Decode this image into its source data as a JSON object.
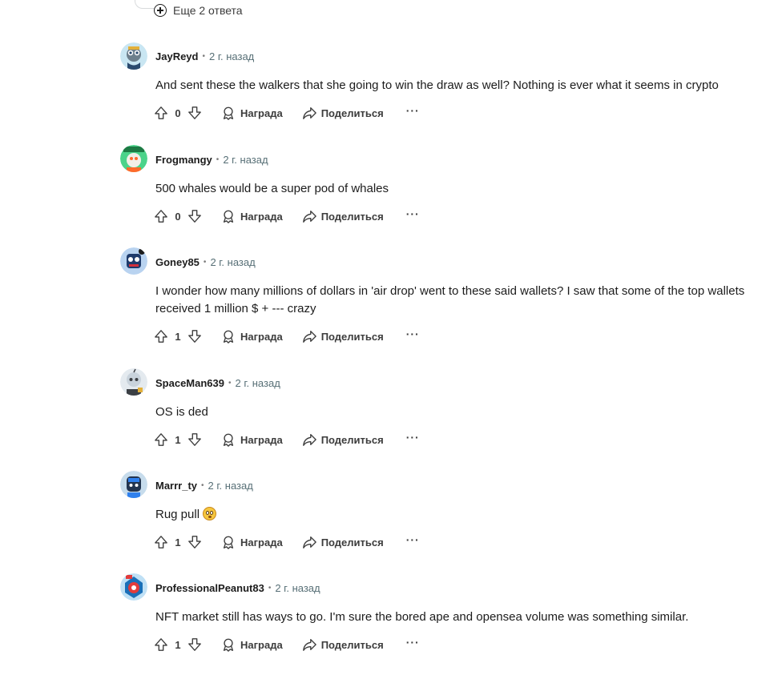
{
  "more_replies": {
    "label": "Еще 2 ответа",
    "icon": "plus-circle-icon"
  },
  "actions": {
    "award": "Награда",
    "share": "Поделиться",
    "more": "···"
  },
  "comments": [
    {
      "author": "JayReyd",
      "time": "2 г. назад",
      "body": "And sent these the walkers that she going to win the draw as well? Nothing is ever what it seems in crypto",
      "score": "0",
      "avatar_colors": [
        "#2a4a6e",
        "#9fb5c8"
      ]
    },
    {
      "author": "Frogmangy",
      "time": "2 г. назад",
      "body": "500 whales would be a super pod of whales",
      "score": "0",
      "avatar_colors": [
        "#2bb673",
        "#ff6a2b"
      ]
    },
    {
      "author": "Goney85",
      "time": "2 г. назад",
      "body": "I wonder how many millions of dollars in 'air drop' went to these said wallets? I saw that some of the top wallets received 1 million $ + --- crazy",
      "score": "1",
      "avatar_colors": [
        "#1f3b6b",
        "#d3303c"
      ]
    },
    {
      "author": "SpaceMan639",
      "time": "2 г. назад",
      "body": "OS is ded",
      "score": "1",
      "avatar_colors": [
        "#c9d3dc",
        "#3b3f44"
      ]
    },
    {
      "author": "Marrr_ty",
      "time": "2 г. назад",
      "body": "Rug pull",
      "score": "1",
      "avatar_colors": [
        "#22344f",
        "#2f80ed"
      ],
      "emoji": "flushed-face-emoji"
    },
    {
      "author": "ProfessionalPeanut83",
      "time": "2 г. назад",
      "body": "NFT market still has ways to go. I'm sure the bored ape and opensea volume was something similar.",
      "score": "1",
      "avatar_colors": [
        "#1a6fb8",
        "#e23b3b"
      ]
    }
  ]
}
